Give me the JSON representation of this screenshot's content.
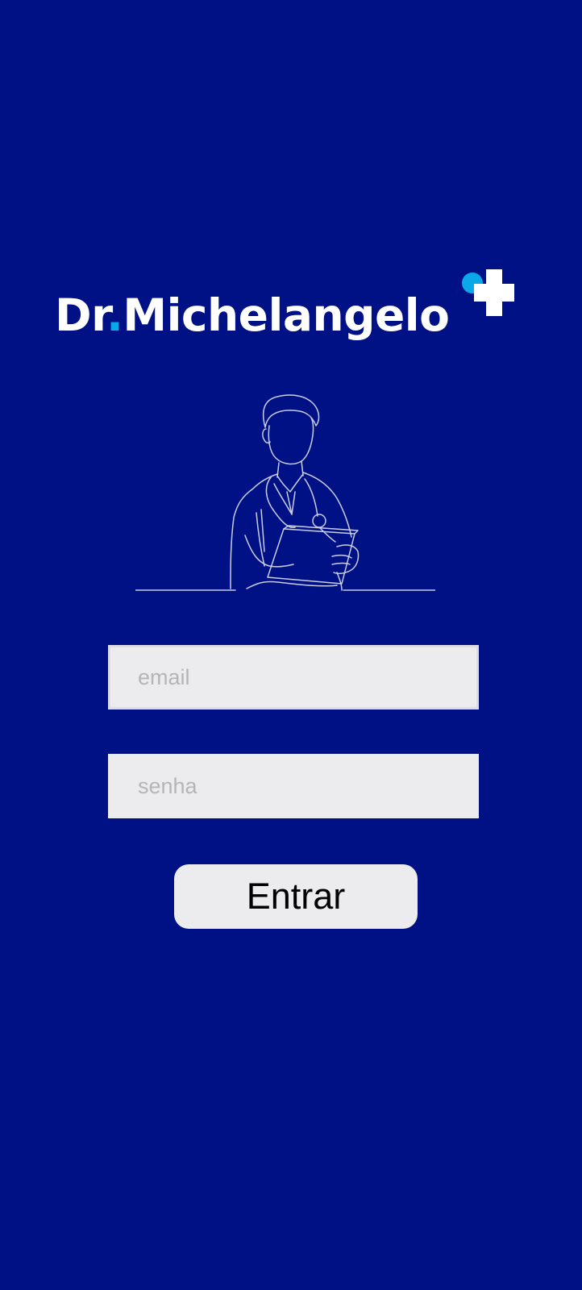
{
  "brand": {
    "name_prefix": "Dr",
    "name_dot": ".",
    "name_suffix": "Michelangelo",
    "primary_color": "#001185",
    "accent_color": "#0aa8e8"
  },
  "login": {
    "email_placeholder": "email",
    "email_value": "",
    "password_placeholder": "senha",
    "password_value": "",
    "submit_label": "Entrar"
  }
}
